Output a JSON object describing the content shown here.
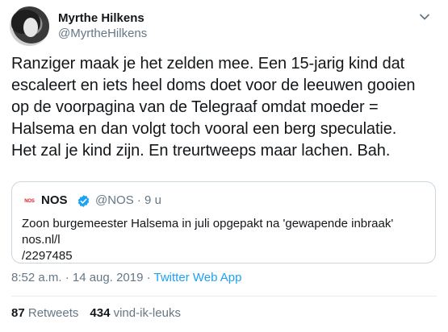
{
  "author": {
    "name": "Myrthe Hilkens",
    "handle": "@MyrtheHilkens"
  },
  "tweet": {
    "lines": [
      "Ranziger maak je het zelden mee. Een 15-jarig kind dat",
      "escaleert en iets heel doms doet voor de leeuwen gooien",
      "op de voorpagina van de Telegraaf omdat moeder =",
      "Halsema en dan volgt toch vooral een berg speculatie.",
      "Het zal je kind zijn. En treurtweeps maar lachen. Bah."
    ]
  },
  "quote": {
    "logo_text": "NOS",
    "name": "NOS",
    "handle_time": "@NOS · 9 u",
    "text_lines": [
      "Zoon burgemeester Halsema in juli opgepakt na 'gewapende inbraak' nos.nl/l",
      "/2297485"
    ]
  },
  "meta": {
    "time_date": "8:52 a.m. · 14 aug. 2019 · ",
    "source": "Twitter Web App"
  },
  "stats": {
    "retweets_count": "87",
    "retweets_label": "Retweets",
    "likes_count": "434",
    "likes_label": "vind-ik-leuks"
  },
  "icons": {
    "more": "chevron-down-icon",
    "verified": "verified-badge-icon"
  },
  "colors": {
    "text": "#14171a",
    "secondary": "#657786",
    "link": "#1da1f2",
    "border": "#ccd6dd",
    "nos_red": "#e31b23"
  }
}
